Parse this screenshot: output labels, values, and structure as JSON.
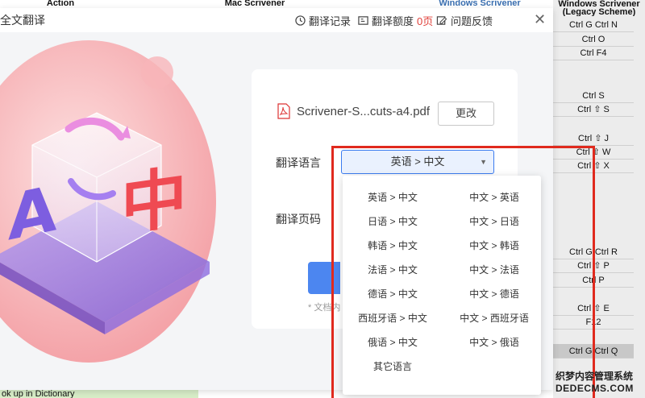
{
  "sheet": {
    "headers": [
      "Action",
      "Mac Scrivener",
      "Windows Scrivener",
      "Windows Scrivener"
    ],
    "right_header_sub": "(Legacy Scheme)",
    "cells": [
      "Ctrl G Ctrl N",
      "Ctrl O",
      "Ctrl F4",
      "Ctrl S",
      "Ctrl ⇧ S",
      "Ctrl ⇧ J",
      "Ctrl ⇧ W",
      "Ctrl ⇧ X",
      "Ctrl G Ctrl R",
      "Ctrl ⇧ P",
      "Ctrl P",
      "Ctrl ⇧ E",
      "F12",
      "Ctrl G Ctrl Q"
    ],
    "bottom_left": "ok up in Dictionary"
  },
  "titlebar": {
    "title": "全文翻译",
    "history": "翻译记录",
    "quota": "翻译额度",
    "quota_value": "0页",
    "feedback": "问题反馈",
    "close": "✕"
  },
  "card": {
    "file_name": "Scrivener-S...cuts-a4.pdf",
    "change_label": "更改",
    "lang_label": "翻译语言",
    "selected_lang": "英语 > 中文",
    "page_label": "翻译页码",
    "note": "* 文档内"
  },
  "dropdown": {
    "left": [
      "英语 > 中文",
      "日语 > 中文",
      "韩语 > 中文",
      "法语 > 中文",
      "德语 > 中文",
      "西班牙语 > 中文",
      "俄语 > 中文",
      "其它语言"
    ],
    "right": [
      "中文 > 英语",
      "中文 > 日语",
      "中文 > 韩语",
      "中文 > 法语",
      "中文 > 德语",
      "中文 > 西班牙语",
      "中文 > 俄语"
    ]
  },
  "watermark": {
    "line1": "织梦内容管理系统",
    "line2": "DEDECMS.COM"
  },
  "colors": {
    "accent": "#3b7cf0",
    "annotation": "#e02a1e",
    "quota_red": "#e0403a"
  }
}
